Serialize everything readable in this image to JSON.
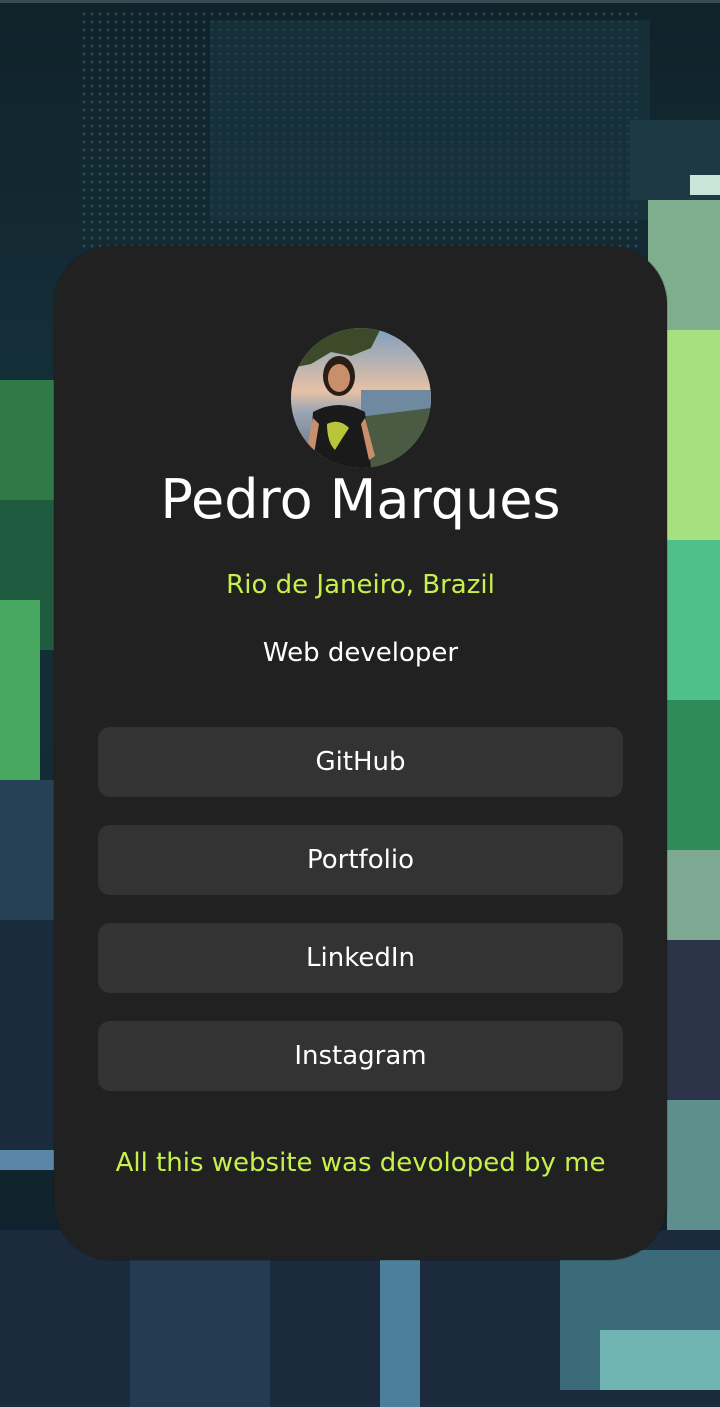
{
  "profile": {
    "name": "Pedro Marques",
    "location": "Rio de Janeiro, Brazil",
    "role": "Web developer",
    "avatar_icon": "profile-photo"
  },
  "links": [
    {
      "label": "GitHub"
    },
    {
      "label": "Portfolio"
    },
    {
      "label": "LinkedIn"
    },
    {
      "label": "Instagram"
    }
  ],
  "footer": {
    "text": "All this website was devoloped by me"
  },
  "colors": {
    "card_bg": "#212121",
    "button_bg": "#333333",
    "accent": "#c6f04c",
    "text": "#ffffff"
  }
}
